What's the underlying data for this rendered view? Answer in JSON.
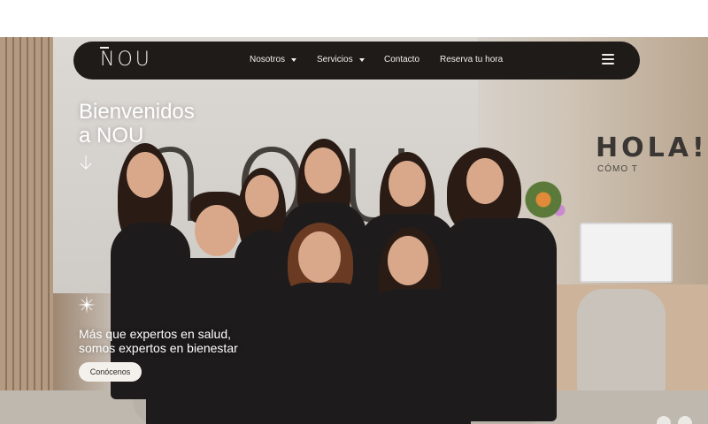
{
  "brand": {
    "name": "NOU"
  },
  "nav": {
    "items": [
      {
        "label": "Nosotros",
        "has_dropdown": true
      },
      {
        "label": "Servicios",
        "has_dropdown": true
      },
      {
        "label": "Contacto",
        "has_dropdown": false
      },
      {
        "label": "Reserva tu hora",
        "has_dropdown": false
      }
    ],
    "menu_icon": "hamburger-icon"
  },
  "hero": {
    "title_line1": "Bienvenidos",
    "title_line2": "a NOU",
    "tagline_line1": "Más que expertos en salud,",
    "tagline_line2": "somos expertos en bienestar",
    "cta_label": "Conócenos",
    "wall_logo": "nou",
    "wall_sign": "HOLA!",
    "wall_sign_sub": "CÓMO T"
  },
  "colors": {
    "nav_bg": "#1f1b19",
    "nav_text": "#f3efe9",
    "cta_bg": "#f4f1ed",
    "hero_text": "#ffffff"
  },
  "icons": {
    "scroll": "arrow-down-icon",
    "decor": "sparkle-icon",
    "dropdown": "chevron-down-icon"
  }
}
